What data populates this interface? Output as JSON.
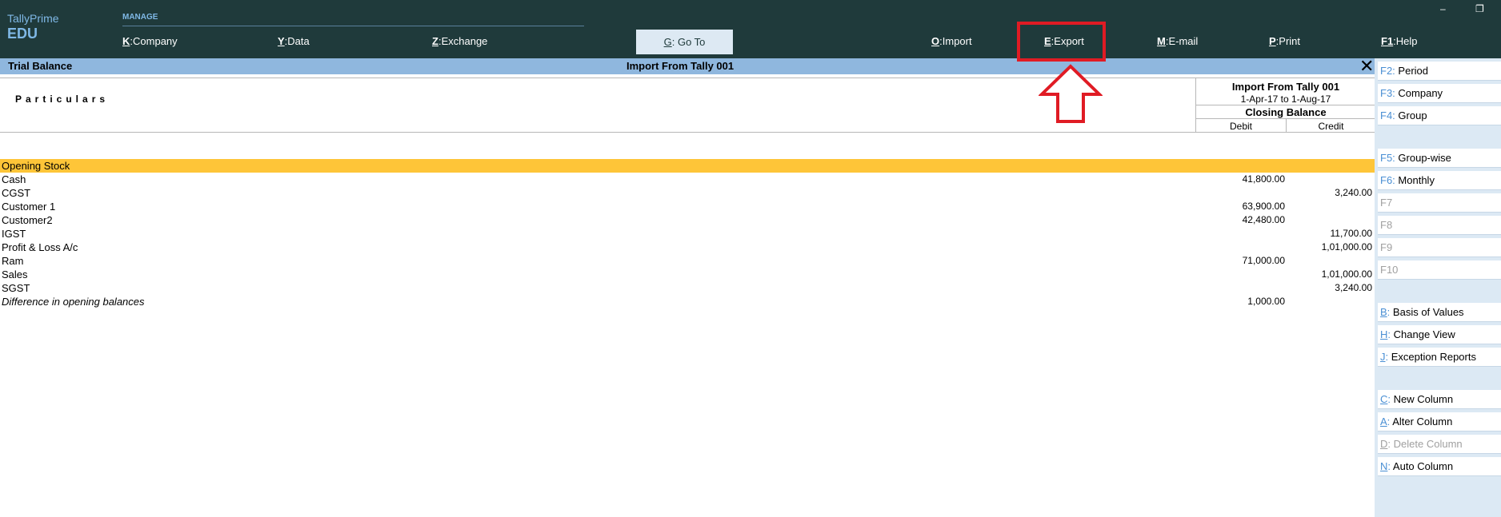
{
  "app": {
    "brand_line1": "TallyPrime",
    "brand_line2": "EDU"
  },
  "topmenu": {
    "section": "MANAGE",
    "items": [
      {
        "key": "K",
        "label": "Company"
      },
      {
        "key": "Y",
        "label": "Data"
      },
      {
        "key": "Z",
        "label": "Exchange"
      }
    ],
    "goto": {
      "key": "G",
      "label": "Go To"
    },
    "right_items": [
      {
        "key": "O",
        "label": "Import"
      },
      {
        "key": "E",
        "label": "Export"
      },
      {
        "key": "M",
        "label": "E-mail"
      },
      {
        "key": "P",
        "label": "Print"
      },
      {
        "key": "F1",
        "label": "Help"
      }
    ]
  },
  "titlebar": {
    "report": "Trial Balance",
    "company": "Import From Tally 001",
    "close": "✕"
  },
  "header": {
    "particulars": "Particulars",
    "column_company": "Import From Tally 001",
    "period": "1-Apr-17 to 1-Aug-17",
    "closing": "Closing Balance",
    "debit": "Debit",
    "credit": "Credit"
  },
  "rows": [
    {
      "name": "Opening Stock",
      "debit": "",
      "credit": "",
      "highlighted": true
    },
    {
      "name": "Cash",
      "debit": "41,800.00",
      "credit": ""
    },
    {
      "name": "CGST",
      "debit": "",
      "credit": "3,240.00"
    },
    {
      "name": "Customer 1",
      "debit": "63,900.00",
      "credit": ""
    },
    {
      "name": "Customer2",
      "debit": "42,480.00",
      "credit": ""
    },
    {
      "name": "IGST",
      "debit": "",
      "credit": "11,700.00"
    },
    {
      "name": "Profit & Loss A/c",
      "debit": "",
      "credit": "1,01,000.00"
    },
    {
      "name": "Ram",
      "debit": "71,000.00",
      "credit": ""
    },
    {
      "name": "Sales",
      "debit": "",
      "credit": "1,01,000.00"
    },
    {
      "name": "SGST",
      "debit": "",
      "credit": "3,240.00"
    },
    {
      "name": "Difference in opening balances",
      "debit": "1,000.00",
      "credit": "",
      "italic": true
    }
  ],
  "right_panel": {
    "group1": [
      {
        "key": "F2",
        "label": "Period"
      },
      {
        "key": "F3",
        "label": "Company"
      },
      {
        "key": "F4",
        "label": "Group"
      }
    ],
    "group2": [
      {
        "key": "F5",
        "label": "Group-wise"
      },
      {
        "key": "F6",
        "label": "Monthly"
      },
      {
        "key": "F7",
        "label": ""
      },
      {
        "key": "F8",
        "label": ""
      },
      {
        "key": "F9",
        "label": ""
      },
      {
        "key": "F10",
        "label": ""
      }
    ],
    "group3": [
      {
        "key": "B",
        "label": "Basis of Values"
      },
      {
        "key": "H",
        "label": "Change View"
      },
      {
        "key": "J",
        "label": "Exception Reports"
      }
    ],
    "group4": [
      {
        "key": "C",
        "label": "New Column"
      },
      {
        "key": "A",
        "label": "Alter Column"
      },
      {
        "key": "D",
        "label": "Delete Column"
      },
      {
        "key": "N",
        "label": "Auto Column"
      }
    ]
  },
  "window": {
    "minimize": "‒",
    "restore": "❐"
  },
  "colors": {
    "topbar": "#1f3a3b",
    "accent": "#7fb8e6",
    "highlight_row": "#fec538",
    "annotation_red": "#e01b24"
  }
}
